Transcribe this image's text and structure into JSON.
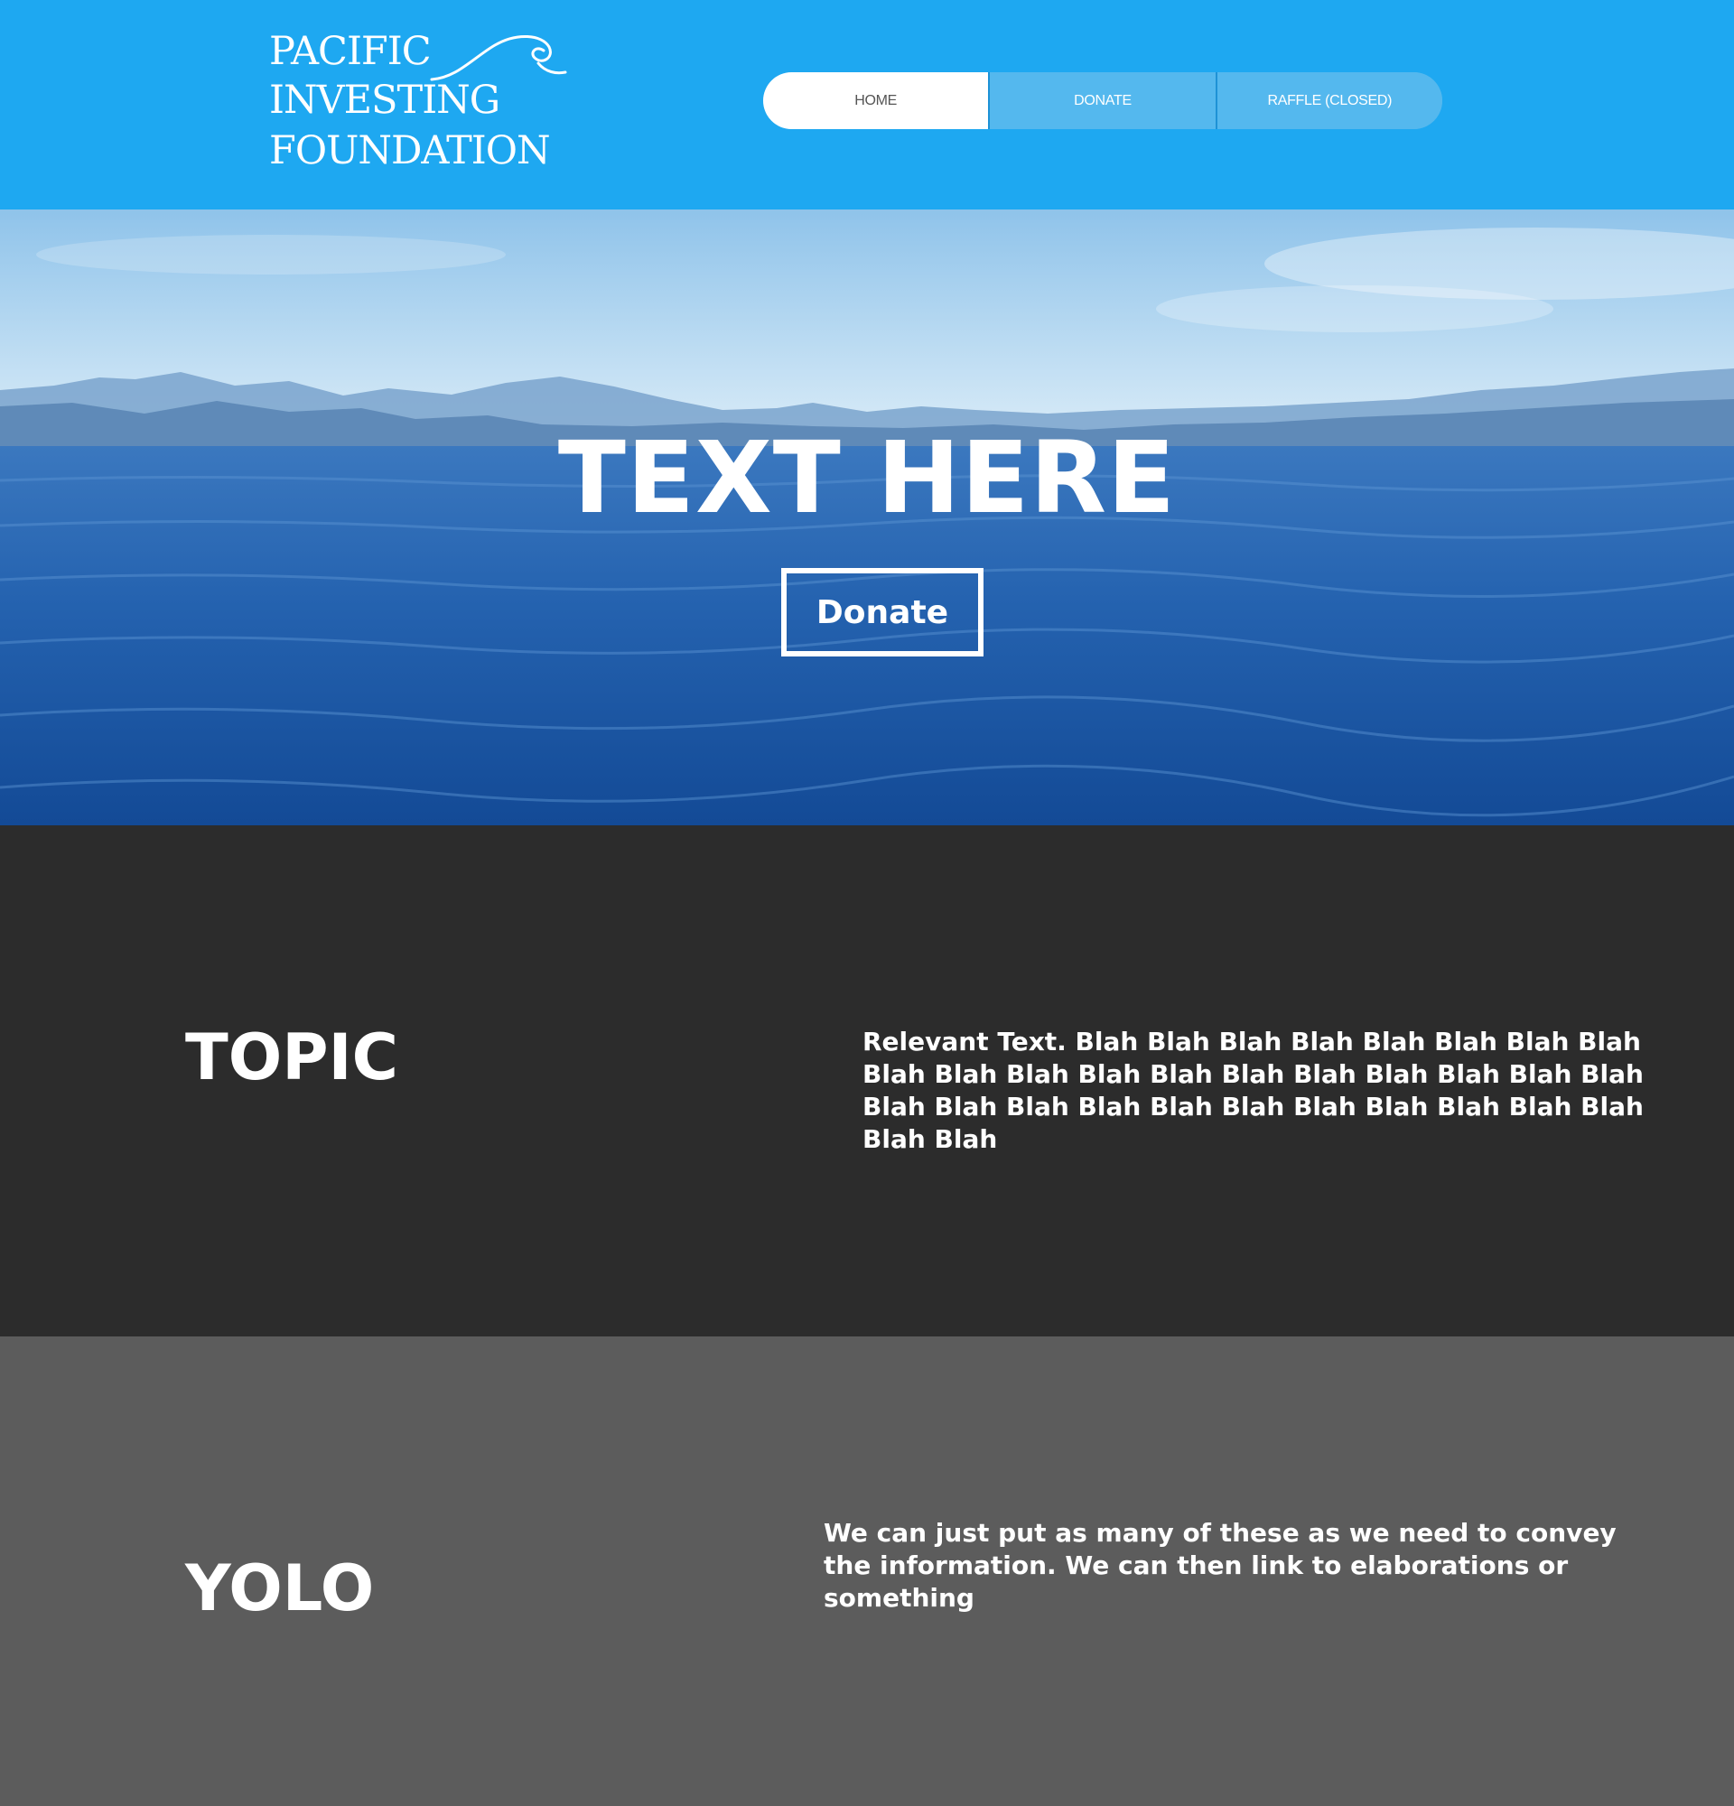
{
  "header": {
    "logo": {
      "line1": "PACIFIC",
      "line2": "INVESTING",
      "line3": "FOUNDATION",
      "icon": "wave-icon"
    },
    "nav": [
      {
        "label": "HOME",
        "active": true
      },
      {
        "label": "DONATE",
        "active": false
      },
      {
        "label": "RAFFLE (CLOSED)",
        "active": false
      }
    ]
  },
  "hero": {
    "title": "TEXT HERE",
    "button_label": "Donate",
    "background": "ocean-and-mountains-photo"
  },
  "sections": [
    {
      "heading": "TOPIC",
      "body": "Relevant Text. Blah Blah Blah Blah Blah Blah Blah Blah Blah Blah Blah Blah Blah Blah Blah Blah Blah Blah Blah Blah Blah Blah Blah Blah Blah Blah Blah Blah Blah Blah Blah Blah"
    },
    {
      "heading": "YOLO",
      "body": "We can just put as many of these as we need to convey the information. We can then link to elaborations or something"
    }
  ],
  "colors": {
    "header_bg": "#1ea8f1",
    "nav_item_bg": "#54b8ee",
    "nav_active_bg": "#ffffff",
    "section1_bg": "#2c2c2c",
    "section2_bg": "#5c5c5c",
    "text": "#ffffff"
  }
}
